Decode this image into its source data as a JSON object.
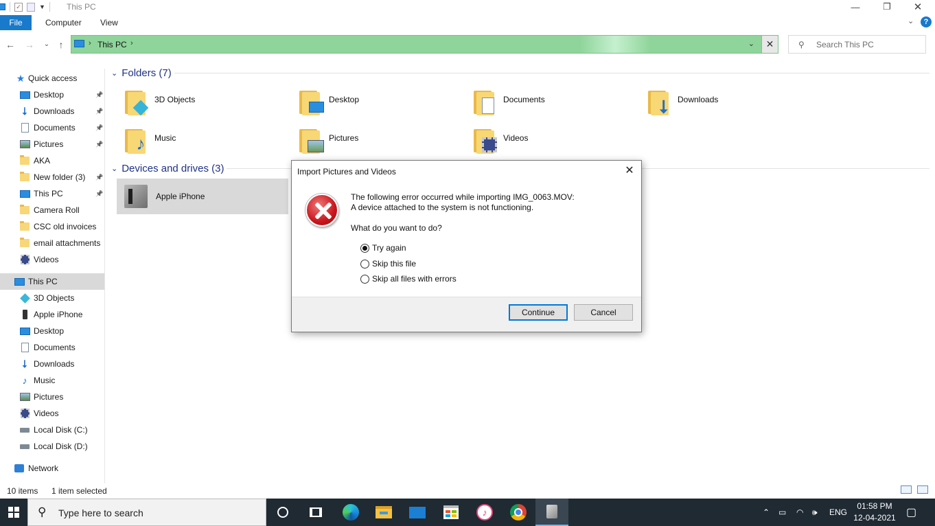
{
  "window": {
    "title": "This PC",
    "minimize_glyph": "—",
    "maximize_glyph": "❐",
    "close_glyph": "✕"
  },
  "ribbon": {
    "tabs": [
      "File",
      "Computer",
      "View"
    ],
    "help_glyph": "?"
  },
  "address": {
    "crumbs": [
      "This PC"
    ],
    "icon": "computer-icon"
  },
  "search": {
    "placeholder": "Search This PC"
  },
  "sidebar": {
    "quick_access": "Quick access",
    "quick_items": [
      {
        "label": "Desktop",
        "icon": "desktop-icon",
        "pinned": true
      },
      {
        "label": "Downloads",
        "icon": "download-arrow-icon",
        "pinned": true
      },
      {
        "label": "Documents",
        "icon": "document-icon",
        "pinned": true
      },
      {
        "label": "Pictures",
        "icon": "pictures-icon",
        "pinned": true
      },
      {
        "label": "AKA",
        "icon": "folder-icon",
        "pinned": false
      },
      {
        "label": "New folder (3)",
        "icon": "folder-icon",
        "pinned": true
      },
      {
        "label": "This PC",
        "icon": "computer-icon",
        "pinned": true
      },
      {
        "label": "Camera Roll",
        "icon": "folder-icon",
        "pinned": false
      },
      {
        "label": "CSC old invoices",
        "icon": "folder-icon",
        "pinned": false
      },
      {
        "label": "email attachments",
        "icon": "folder-icon",
        "pinned": false
      },
      {
        "label": "Videos",
        "icon": "video-icon",
        "pinned": false
      }
    ],
    "this_pc": "This PC",
    "pc_items": [
      {
        "label": "3D Objects",
        "icon": "cube-icon"
      },
      {
        "label": "Apple iPhone",
        "icon": "phone-icon"
      },
      {
        "label": "Desktop",
        "icon": "desktop-icon"
      },
      {
        "label": "Documents",
        "icon": "document-icon"
      },
      {
        "label": "Downloads",
        "icon": "download-arrow-icon"
      },
      {
        "label": "Music",
        "icon": "music-icon"
      },
      {
        "label": "Pictures",
        "icon": "pictures-icon"
      },
      {
        "label": "Videos",
        "icon": "video-icon"
      },
      {
        "label": "Local Disk (C:)",
        "icon": "disk-icon"
      },
      {
        "label": "Local Disk (D:)",
        "icon": "disk-icon"
      }
    ],
    "network": "Network"
  },
  "content": {
    "folders_header": "Folders (7)",
    "folders": [
      {
        "label": "3D Objects",
        "icon": "cube-icon"
      },
      {
        "label": "Desktop",
        "icon": "desktop-icon"
      },
      {
        "label": "Documents",
        "icon": "document-icon"
      },
      {
        "label": "Downloads",
        "icon": "download-arrow-icon"
      },
      {
        "label": "Music",
        "icon": "music-icon"
      },
      {
        "label": "Pictures",
        "icon": "pictures-icon"
      },
      {
        "label": "Videos",
        "icon": "video-icon"
      }
    ],
    "devices_header": "Devices and drives (3)",
    "device": "Apple iPhone"
  },
  "status": {
    "items": "10 items",
    "selected": "1 item selected"
  },
  "dialog": {
    "title": "Import Pictures and Videos",
    "line1": "The following error occurred while importing IMG_0063.MOV:",
    "line2": "A device attached to the system is not functioning.",
    "question": "What do you want to do?",
    "options": [
      "Try again",
      "Skip this file",
      "Skip all files with errors"
    ],
    "selected_option": "Try again",
    "continue_label": "Continue",
    "cancel_label": "Cancel",
    "icon": "error-icon"
  },
  "taskbar": {
    "search_placeholder": "Type here to search",
    "apps": [
      "cortana-icon",
      "task-view-icon",
      "edge-icon",
      "file-explorer-icon",
      "mail-icon",
      "store-icon",
      "itunes-icon",
      "chrome-icon",
      "device-icon"
    ],
    "language": "ENG",
    "time": "01:58 PM",
    "date": "12-04-2021"
  },
  "colors": {
    "accent": "#1979ca",
    "address_bar": "#8fd49a",
    "error_red": "#c8161d",
    "taskbar": "#1f2a33"
  }
}
